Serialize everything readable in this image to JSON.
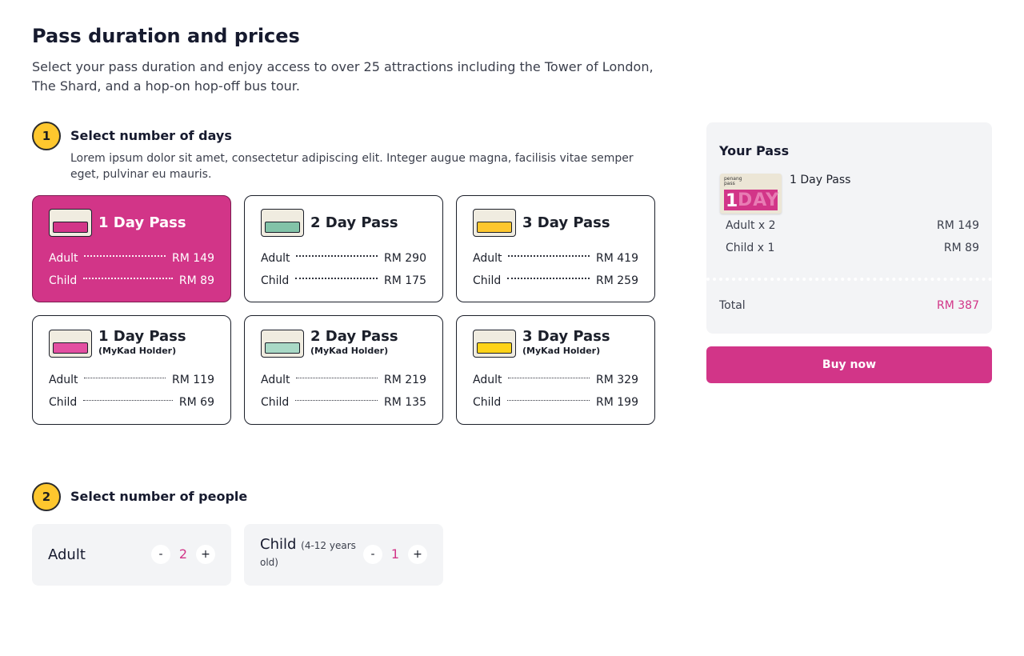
{
  "header": {
    "title": "Pass duration and prices",
    "description": "Select your pass duration and enjoy access to over 25 attractions including the Tower of London, The Shard, and a hop-on hop-off bus tour."
  },
  "step1": {
    "number": "1",
    "title": "Select number of days",
    "description": "Lorem ipsum dolor sit amet, consectetur adipiscing elit. Integer augue magna, facilisis vitae semper eget, pulvinar eu mauris."
  },
  "passes": [
    {
      "title": "1 Day Pass",
      "subtitle": "",
      "adult_label": "Adult",
      "adult_price": "RM 149",
      "child_label": "Child",
      "child_price": "RM 89",
      "selected": true,
      "color": "#d23588"
    },
    {
      "title": "2 Day Pass",
      "subtitle": "",
      "adult_label": "Adult",
      "adult_price": "RM 290",
      "child_label": "Child",
      "child_price": "RM 175",
      "selected": false,
      "color": "#82c3a8"
    },
    {
      "title": "3 Day Pass",
      "subtitle": "",
      "adult_label": "Adult",
      "adult_price": "RM 419",
      "child_label": "Child",
      "child_price": "RM 259",
      "selected": false,
      "color": "#fec72e"
    },
    {
      "title": "1 Day Pass",
      "subtitle": "(MyKad Holder)",
      "adult_label": "Adult",
      "adult_price": "RM 119",
      "child_label": "Child",
      "child_price": "RM 69",
      "selected": false,
      "color": "#e34fa1"
    },
    {
      "title": "2 Day Pass",
      "subtitle": "(MyKad Holder)",
      "adult_label": "Adult",
      "adult_price": "RM 219",
      "child_label": "Child",
      "child_price": "RM 135",
      "selected": false,
      "color": "#a9d9c6"
    },
    {
      "title": "3 Day Pass",
      "subtitle": "(MyKad Holder)",
      "adult_label": "Adult",
      "adult_price": "RM 329",
      "child_label": "Child",
      "child_price": "RM 199",
      "selected": false,
      "color": "#fed318"
    }
  ],
  "step2": {
    "number": "2",
    "title": "Select number of people"
  },
  "people": {
    "adult": {
      "label": "Adult",
      "count": "2",
      "minus": "-",
      "plus": "+"
    },
    "child": {
      "label": "Child",
      "sub": "(4-12 years",
      "sub2": "old)",
      "count": "1",
      "minus": "-",
      "plus": "+"
    }
  },
  "summary": {
    "title": "Your Pass",
    "pass_name": "1 Day Pass",
    "image_brand": "penang pass",
    "image_num": "1",
    "image_word": "DAY",
    "lines": [
      {
        "label": "Adult x 2",
        "price": "RM 149"
      },
      {
        "label": "Child x 1",
        "price": "RM 89"
      }
    ],
    "total_label": "Total",
    "total_value": "RM 387"
  },
  "buy_button": "Buy now",
  "colors": {
    "accent": "#d23588",
    "badge": "#fec72e",
    "panel": "#f3f4f6"
  }
}
